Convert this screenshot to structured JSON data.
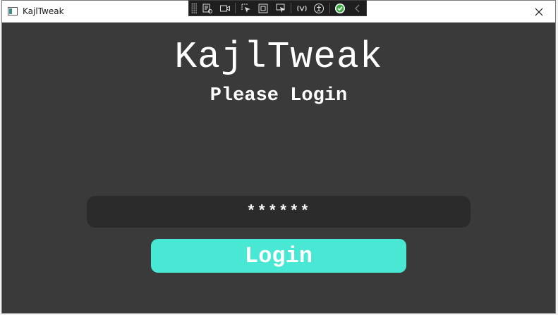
{
  "window": {
    "title": "KajlTweak"
  },
  "devtools": {
    "icons": [
      "visual-tree-icon",
      "record-icon",
      "select-element-icon",
      "display-layout-icon",
      "track-focus-icon",
      "hot-reload-icon",
      "accessibility-icon",
      "verified-icon",
      "collapse-icon"
    ]
  },
  "main": {
    "app_title": "KajlTweak",
    "subtitle": "Please Login",
    "password_value": "******",
    "login_label": "Login"
  },
  "colors": {
    "background": "#3a3a3a",
    "field_background": "#2b2b2b",
    "accent": "#48e8d4"
  }
}
